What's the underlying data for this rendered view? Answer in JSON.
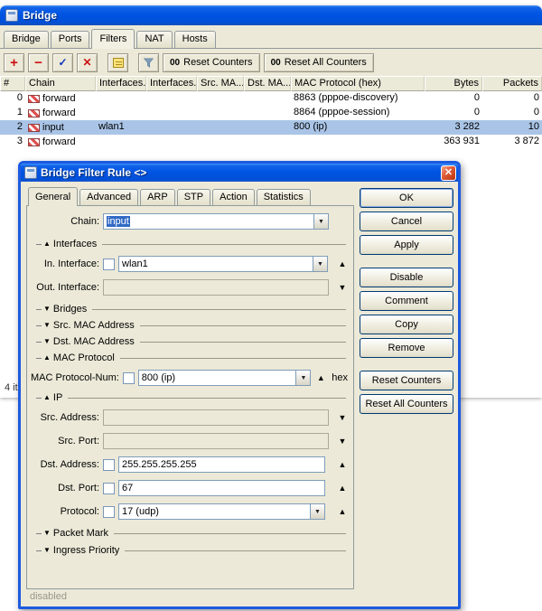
{
  "icons": {
    "add": "+",
    "remove": "−",
    "enable": "✓",
    "disable": "✕",
    "close": "✕",
    "dropdown": "▼",
    "up": "▲",
    "down": "▼",
    "counters_badge": "00"
  },
  "main_window": {
    "title": "Bridge",
    "tabs": [
      "Bridge",
      "Ports",
      "Filters",
      "NAT",
      "Hosts"
    ],
    "toolbar": {
      "reset_counters_label": "Reset Counters",
      "reset_all_counters_label": "Reset All Counters"
    },
    "table": {
      "columns": [
        "#",
        "Chain",
        "Interfaces...",
        "Interfaces...",
        "Src. MA...",
        "Dst. MA...",
        "MAC Protocol (hex)",
        "Bytes",
        "Packets"
      ],
      "rows": [
        {
          "num": "0",
          "chain": "forward",
          "in_interface": "",
          "mac_protocol": "8863 (pppoe-discovery)",
          "bytes": "0",
          "packets": "0"
        },
        {
          "num": "1",
          "chain": "forward",
          "in_interface": "",
          "mac_protocol": "8864 (pppoe-session)",
          "bytes": "0",
          "packets": "0"
        },
        {
          "num": "2",
          "chain": "input",
          "in_interface": "wlan1",
          "mac_protocol": "800 (ip)",
          "bytes": "3 282",
          "packets": "10"
        },
        {
          "num": "3",
          "chain": "forward",
          "in_interface": "",
          "mac_protocol": "",
          "bytes": "363 931",
          "packets": "3 872"
        }
      ]
    },
    "status_bar": "4 items"
  },
  "dialog": {
    "title": "Bridge Filter Rule <>",
    "tabs": [
      "General",
      "Advanced",
      "ARP",
      "STP",
      "Action",
      "Statistics"
    ],
    "buttons": [
      "OK",
      "Cancel",
      "Apply",
      "Disable",
      "Comment",
      "Copy",
      "Remove",
      "Reset Counters",
      "Reset All Counters"
    ],
    "fields": {
      "chain": {
        "label": "Chain:",
        "value": "input"
      },
      "in_interface": {
        "label": "In. Interface:",
        "value": "wlan1"
      },
      "out_interface": {
        "label": "Out. Interface:",
        "value": ""
      },
      "mac_protocol_num": {
        "label": "MAC Protocol-Num:",
        "value": "800 (ip)",
        "suffix": "hex"
      },
      "src_address": {
        "label": "Src. Address:",
        "value": ""
      },
      "src_port": {
        "label": "Src. Port:",
        "value": ""
      },
      "dst_address": {
        "label": "Dst. Address:",
        "value": "255.255.255.255"
      },
      "dst_port": {
        "label": "Dst. Port:",
        "value": "67"
      },
      "protocol": {
        "label": "Protocol:",
        "value": "17 (udp)"
      }
    },
    "sections": {
      "interfaces": {
        "label": "Interfaces"
      },
      "bridges": {
        "label": "Bridges"
      },
      "src_mac_address": {
        "label": "Src. MAC Address"
      },
      "dst_mac_address": {
        "label": "Dst. MAC Address"
      },
      "mac_protocol": {
        "label": "MAC Protocol"
      },
      "ip": {
        "label": "IP"
      },
      "packet_mark": {
        "label": "Packet Mark"
      },
      "ingress_priority": {
        "label": "Ingress Priority"
      }
    },
    "status": "disabled"
  }
}
